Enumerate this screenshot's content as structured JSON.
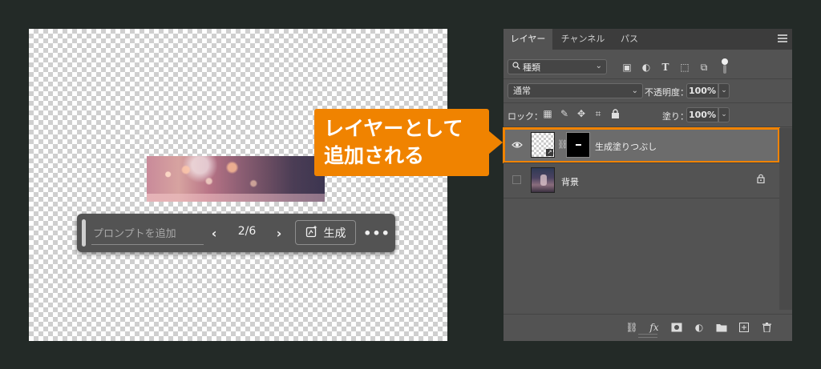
{
  "canvas": {
    "taskbar": {
      "prompt_placeholder": "プロンプトを追加",
      "prev_icon": "‹",
      "page_counter": "2/6",
      "next_icon": "›",
      "generate_label": "生成",
      "more_icon": "•••"
    }
  },
  "callout": {
    "line1": "レイヤーとして",
    "line2": "追加される",
    "color": "#f08300"
  },
  "panel": {
    "tabs": [
      {
        "label": "レイヤー",
        "active": true
      },
      {
        "label": "チャンネル",
        "active": false
      },
      {
        "label": "パス",
        "active": false
      }
    ],
    "filter": {
      "label": "種類",
      "icon": "search-icon"
    },
    "blend_mode": "通常",
    "opacity_label": "不透明度：",
    "opacity_value": "100%",
    "lock_label": "ロック：",
    "fill_label": "塗り：",
    "fill_value": "100%",
    "layers": [
      {
        "name": "生成塗りつぶし",
        "visible": true,
        "selected": true
      },
      {
        "name": "背景",
        "visible": false,
        "locked": true
      }
    ]
  }
}
